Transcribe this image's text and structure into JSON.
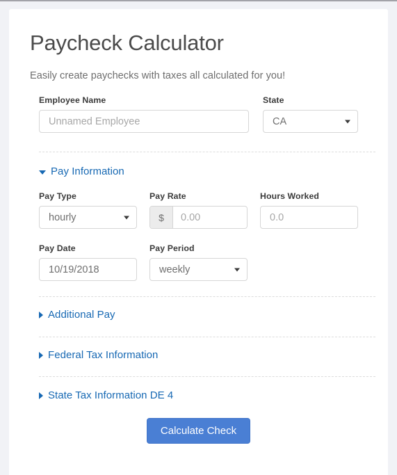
{
  "header": {
    "title": "Paycheck Calculator",
    "subtitle": "Easily create paychecks with taxes all calculated for you!"
  },
  "colors": {
    "accent_link": "#1668b3",
    "button_primary": "#4a7fd4",
    "page_background": "#f1f2f6",
    "card_background": "#ffffff",
    "border": "#d6d6d6",
    "divider": "#dcdcdc",
    "label_text": "#3a3a3a",
    "placeholder_text": "#a7a7a7"
  },
  "form": {
    "employee_name": {
      "label": "Employee Name",
      "value": "",
      "placeholder": "Unnamed Employee"
    },
    "state": {
      "label": "State",
      "value": "CA",
      "caret_icon": "chevron-down-icon"
    },
    "pay_type": {
      "label": "Pay Type",
      "value": "hourly",
      "caret_icon": "chevron-down-icon"
    },
    "pay_rate": {
      "label": "Pay Rate",
      "currency_prefix": "$",
      "value": "",
      "placeholder": "0.00"
    },
    "hours_worked": {
      "label": "Hours Worked",
      "value": "",
      "placeholder": "0.0"
    },
    "pay_date": {
      "label": "Pay Date",
      "value": "10/19/2018",
      "placeholder": ""
    },
    "pay_period": {
      "label": "Pay Period",
      "value": "weekly",
      "caret_icon": "chevron-down-icon"
    }
  },
  "sections": [
    {
      "label": "Pay Information",
      "expanded": true,
      "icon": "triangle-down-icon"
    },
    {
      "label": "Additional Pay",
      "expanded": false,
      "icon": "triangle-right-icon"
    },
    {
      "label": "Federal Tax Information",
      "expanded": false,
      "icon": "triangle-right-icon"
    },
    {
      "label": "State Tax Information DE 4",
      "expanded": false,
      "icon": "triangle-right-icon"
    }
  ],
  "actions": {
    "calculate_label": "Calculate Check"
  }
}
